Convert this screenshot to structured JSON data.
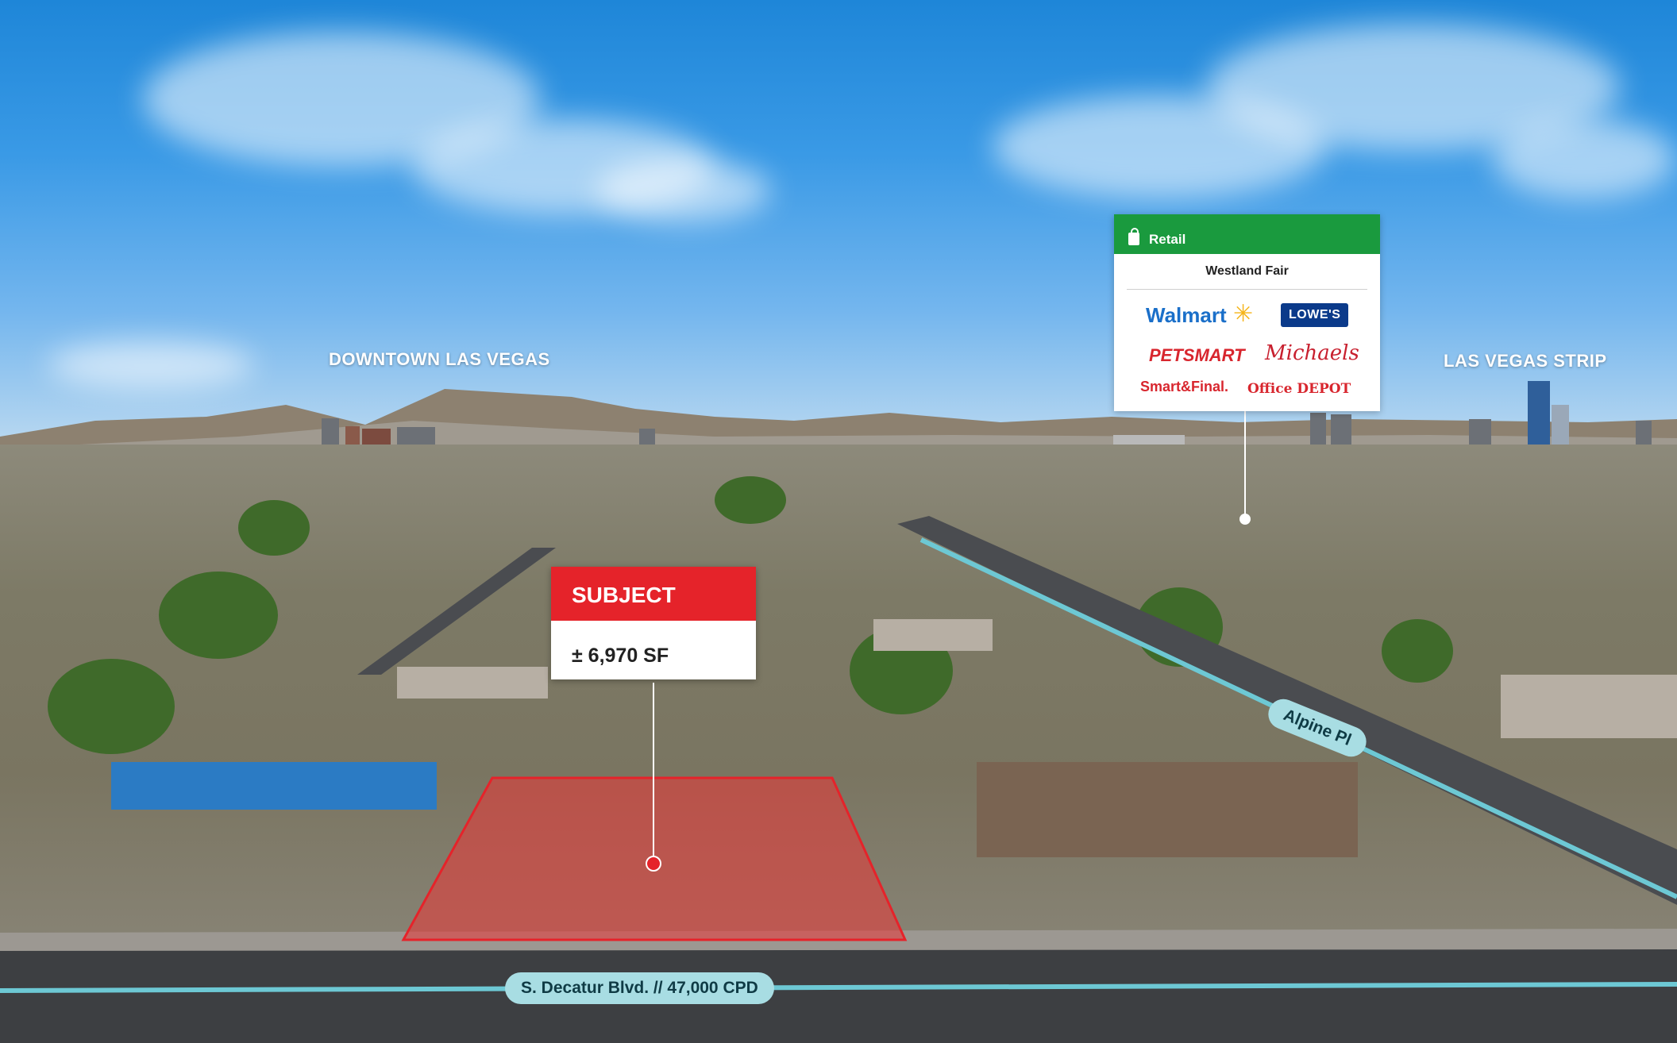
{
  "labels": {
    "left_city": "DOWNTOWN LAS VEGAS",
    "right_city": "LAS VEGAS STRIP"
  },
  "subject": {
    "heading": "SUBJECT",
    "area": "± 6,970 SF"
  },
  "retail": {
    "category": "Retail",
    "center_name": "Westland Fair",
    "tenants": [
      "Walmart",
      "LOWE'S",
      "PETSMART",
      "Michaels",
      "Smart&Final.",
      "Office DEPOT"
    ]
  },
  "roads": {
    "main": "S. Decatur Blvd. // 47,000 CPD",
    "side": "Alpine Pl"
  },
  "colors": {
    "subject_red": "#e5232a",
    "retail_green": "#1a9a3e",
    "road_label_bg": "#a8dde3"
  }
}
